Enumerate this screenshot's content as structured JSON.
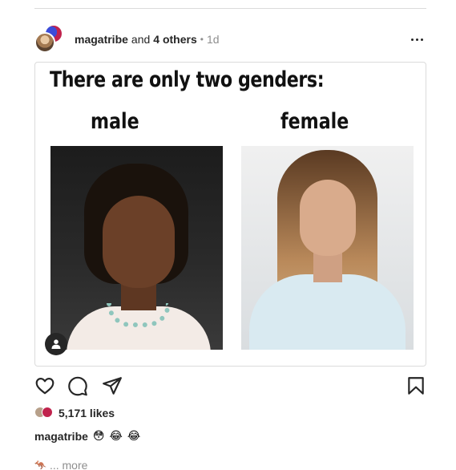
{
  "post": {
    "username": "magatribe",
    "and_text": "and",
    "others": "4 others",
    "separator": "•",
    "time": "1d"
  },
  "media": {
    "title": "There are only two genders:",
    "label_left": "male",
    "label_right": "female",
    "user_tag_icon": "user-tag-icon"
  },
  "actions": {
    "like_icon": "heart-icon",
    "comment_icon": "comment-icon",
    "share_icon": "paper-plane-icon",
    "save_icon": "bookmark-icon"
  },
  "likes": {
    "count_text": "5,171 likes"
  },
  "caption": {
    "username": "magatribe",
    "emojis": [
      "😳",
      "😂",
      "😂"
    ]
  },
  "more": {
    "emoji": "🦘",
    "text": "... more"
  }
}
